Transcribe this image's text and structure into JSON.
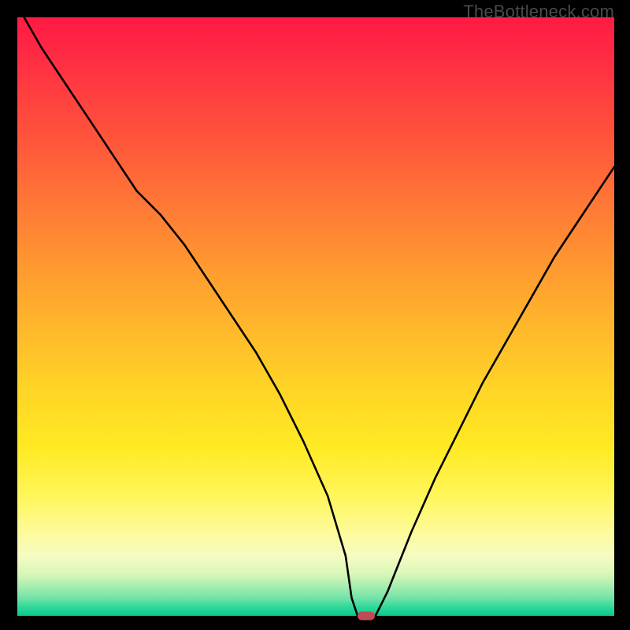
{
  "watermark": "TheBottleneck.com",
  "colors": {
    "page_bg": "#000000",
    "curve_stroke": "#000000",
    "marker_fill": "#c24a55"
  },
  "chart_data": {
    "type": "line",
    "title": "",
    "xlabel": "",
    "ylabel": "",
    "xlim": [
      0,
      100
    ],
    "ylim": [
      0,
      100
    ],
    "series": [
      {
        "name": "bottleneck-curve",
        "x": [
          0,
          4,
          8,
          12,
          16,
          20,
          24,
          28,
          32,
          36,
          40,
          44,
          48,
          52,
          55,
          56,
          57,
          58,
          60,
          62,
          66,
          70,
          74,
          78,
          82,
          86,
          90,
          94,
          98,
          100
        ],
        "values": [
          102,
          95,
          89,
          83,
          77,
          71,
          67,
          62,
          56,
          50,
          44,
          37,
          29,
          20,
          10,
          3,
          0,
          0,
          0,
          4,
          14,
          23,
          31,
          39,
          46,
          53,
          60,
          66,
          72,
          75
        ]
      }
    ],
    "annotations": [
      {
        "name": "min-marker",
        "x": 58.5,
        "y": 0
      }
    ],
    "gradient_stops": [
      {
        "pos": 0,
        "color": "#ff1a44"
      },
      {
        "pos": 0.5,
        "color": "#ffd426"
      },
      {
        "pos": 0.92,
        "color": "#f6fbc3"
      },
      {
        "pos": 1.0,
        "color": "#08c98c"
      }
    ]
  }
}
